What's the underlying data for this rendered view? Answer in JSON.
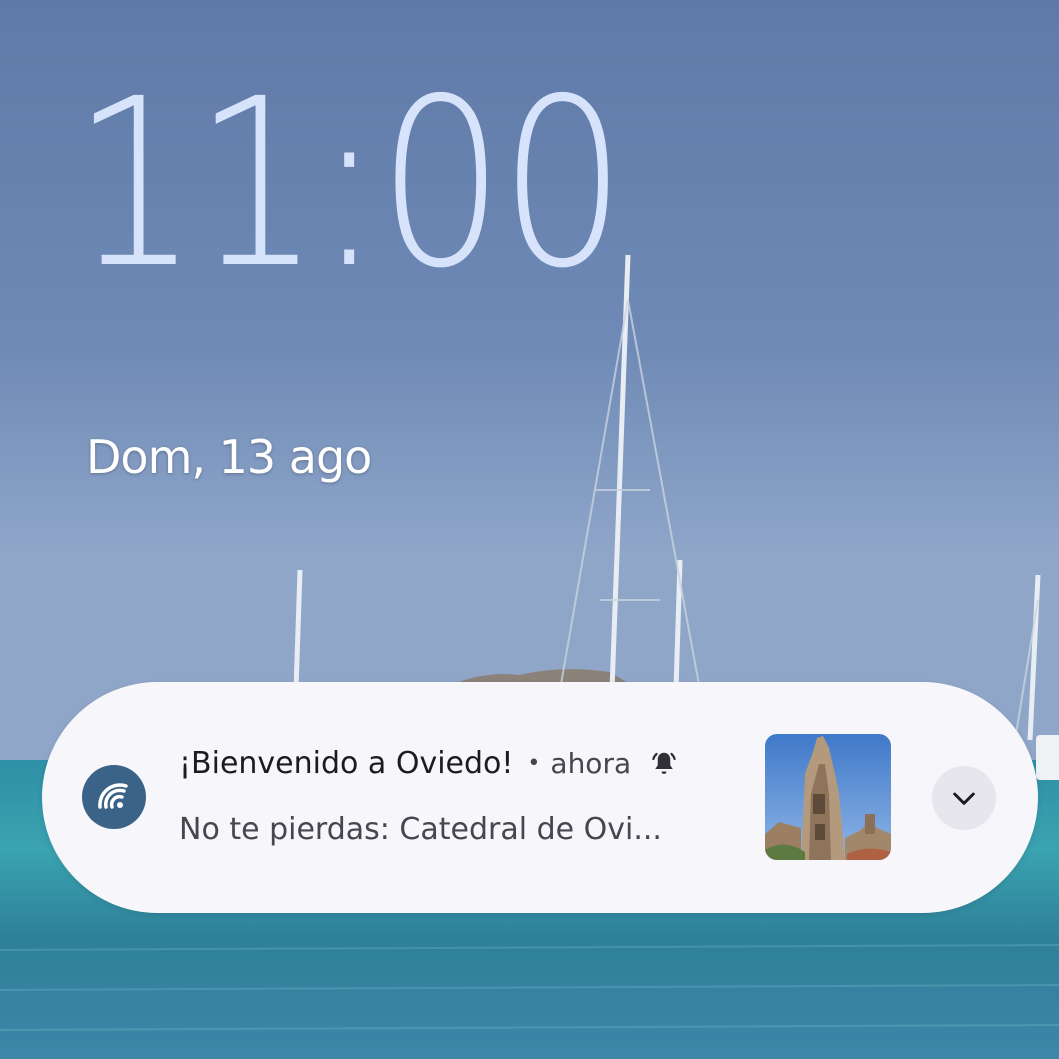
{
  "lockscreen": {
    "time": "11:00",
    "date": "Dom, 13 ago"
  },
  "notification": {
    "app_icon": "wifi-shell-app-icon",
    "title": "¡Bienvenido a Oviedo!",
    "separator": "•",
    "time": "ahora",
    "alert_icon": "bell-ringing-icon",
    "body": "No te pierdas:  Catedral de Ovi...",
    "thumbnail": "cathedral-thumbnail",
    "expand_icon": "chevron-down-icon"
  },
  "colors": {
    "clock": "#d6e3fb",
    "notification_bg": "#f7f6fa",
    "app_icon_bg": "#3b6287",
    "expand_bg": "#e7e6ed"
  }
}
